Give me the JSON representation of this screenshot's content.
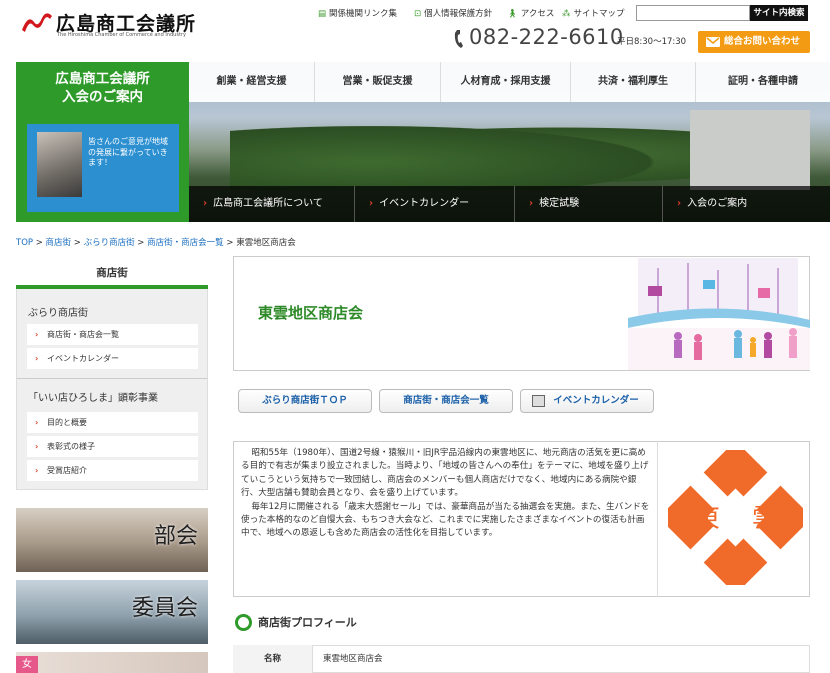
{
  "header": {
    "logo_ja": "広島商工会議所",
    "logo_en": "The Hiroshima Chamber of Commerce and Industry",
    "links": [
      {
        "label": "関係機関リンク集",
        "icon": "list-icon"
      },
      {
        "label": "個人情報保護方針",
        "icon": "lock-icon"
      },
      {
        "label": "アクセス",
        "icon": "walk-icon"
      },
      {
        "label": "サイトマップ",
        "icon": "sitemap-icon"
      }
    ],
    "search_placeholder": "",
    "search_button": "サイト内検索",
    "phone": "082-222-6610",
    "phone_hours": "平日8:30〜17:30",
    "contact_button": "総合お問い合わせ"
  },
  "nav": {
    "items": [
      "創業・経営支援",
      "営業・販促支援",
      "人材育成・採用支援",
      "共済・福利厚生",
      "証明・各種申請"
    ]
  },
  "hero": {
    "panel_title_1": "広島商工会議所",
    "panel_title_2": "入会のご案内",
    "blue_text": "皆さんのご意見が地域の発展に繋がっていきます！",
    "sub_items": [
      "広島商工会議所について",
      "イベントカレンダー",
      "検定試験",
      "入会のご案内"
    ]
  },
  "breadcrumb": {
    "items": [
      "TOP",
      "商店街",
      "ぶらり商店街",
      "商店街・商店会一覧",
      "東雲地区商店会"
    ],
    "sep": " > "
  },
  "sidebar": {
    "title": "商店街",
    "section1": "ぶらり商店街",
    "links1": [
      "商店街・商店会一覧",
      "イベントカレンダー"
    ],
    "section2": "「いい店ひろしま」顕彰事業",
    "links2": [
      "目的と概要",
      "表彰式の様子",
      "受賞店紹介"
    ],
    "banners": [
      "部会",
      "委員会"
    ],
    "woman_tag": "女"
  },
  "main": {
    "title": "東雲地区商店会",
    "buttons": [
      "ぶらり商店街ＴＯＰ",
      "商店街・商店会一覧",
      "イベントカレンダー"
    ],
    "description_1": "昭和55年（1980年）、国道2号線・猿猴川・旧JR宇品沿線内の東雲地区に、地元商店の活気を更に高める目的で有志が集まり設立されました。当時より、「地域の皆さんへの奉仕」をテーマに、地域を盛り上げていこうという気持ちで一致団結し、商店会のメンバーも個人商店だけでなく、地域内にある病院や銀行、大型店舗も賛助会員となり、会を盛り上げています。",
    "description_2": "毎年12月に開催される「歳末大感謝セール」では、豪華商品が当たる抽選会を実施。また、生バンドを使った本格的なのど自慢大会、もちつき大会など、これまでに実施したさまざまなイベントの復活も計画中で、地域への恩返しも含めた商店会の活性化を目指しています。",
    "seal_chars": [
      "東",
      "雲"
    ],
    "profile_heading": "商店街プロフィール",
    "profile_rows": [
      {
        "label": "名称",
        "value": "東雲地区商店会"
      }
    ]
  },
  "colors": {
    "green": "#2e9a2a",
    "orange": "#f39b12",
    "red": "#e03c2c",
    "blue": "#2b8fd0",
    "seal": "#f06a2a"
  }
}
